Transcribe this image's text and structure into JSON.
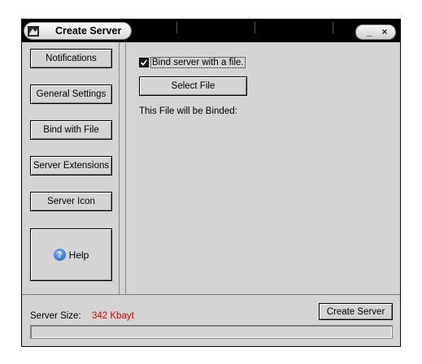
{
  "window": {
    "title": "Create Server",
    "icons": {
      "app": "app-icon",
      "minimize": "minimize-icon",
      "close": "close-icon"
    },
    "controls": {
      "minimize": "_",
      "close": "×"
    }
  },
  "sidebar": {
    "items": [
      {
        "label": "Notifications"
      },
      {
        "label": "General Settings"
      },
      {
        "label": "Bind with File"
      },
      {
        "label": "Server Extensions"
      },
      {
        "label": "Server Icon"
      }
    ],
    "help": {
      "label": "Help",
      "icon": "help-icon",
      "glyph": "?"
    }
  },
  "main": {
    "bind_checkbox": {
      "label": "Bind server with a file.",
      "checked": true
    },
    "select_file_label": "Select File",
    "bind_info": "This File will be Binded:"
  },
  "footer": {
    "size_label": "Server Size:",
    "size_value": "342 Kbayt",
    "create_label": "Create Server",
    "progress": 0
  },
  "colors": {
    "window_bg": "#d4d4d4",
    "titlebar": "#000000",
    "size_value": "#e00000"
  }
}
